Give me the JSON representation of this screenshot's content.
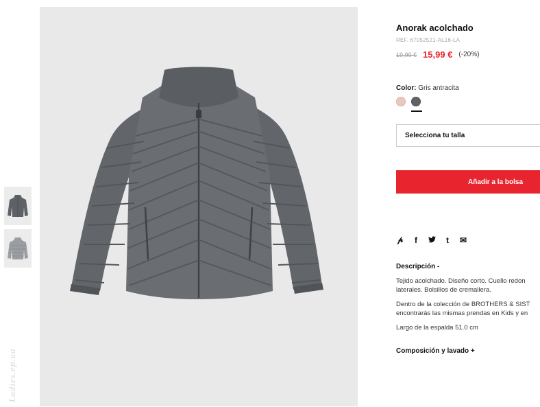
{
  "product": {
    "title": "Anorak acolchado",
    "ref": "REF. 67052521-AL16-LA",
    "old_price": "19,99 €",
    "new_price": "15,99 €",
    "discount": "(-20%)"
  },
  "color": {
    "label": "Color:",
    "value": "Gris antracita",
    "swatches": [
      {
        "name": "rosa",
        "hex": "#e8c9c0",
        "selected": false
      },
      {
        "name": "gris antracita",
        "hex": "#5f6367",
        "selected": true
      }
    ]
  },
  "size_select": {
    "label": "Selecciona tu talla"
  },
  "add_to_bag": {
    "label": "Añadir a la bolsa"
  },
  "share_icons": [
    {
      "name": "pinterest-icon",
      "glyph": "𝓅"
    },
    {
      "name": "facebook-icon",
      "glyph": "f"
    },
    {
      "name": "twitter-icon",
      "glyph": "🐦"
    },
    {
      "name": "tumblr-icon",
      "glyph": "t"
    },
    {
      "name": "email-icon",
      "glyph": "✉"
    }
  ],
  "description": {
    "heading": "Descripción  -",
    "p1a": "Tejido acolchado. Diseño corto. Cuello redon",
    "p1b": "laterales. Bolsillos de cremallera.",
    "p2a": "Dentro de la colección de BROTHERS & SIST",
    "p2b": "encontrarás las mismas prendas en Kids y en",
    "p3": "Largo de la espalda 51.0 cm"
  },
  "composition": {
    "heading": "Composición y lavado  +"
  },
  "watermark": "Ladies.ep.ua",
  "colors": {
    "accent": "#e8252f",
    "jacket": "#6a6e72",
    "background": "#e9e9e9"
  }
}
